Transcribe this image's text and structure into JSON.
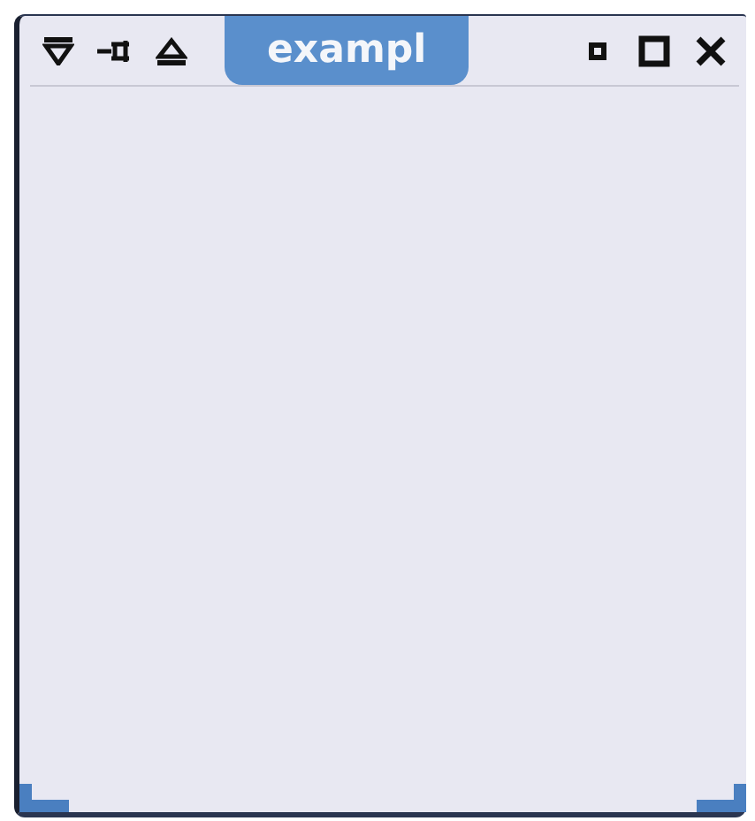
{
  "window": {
    "title": "exampl"
  }
}
